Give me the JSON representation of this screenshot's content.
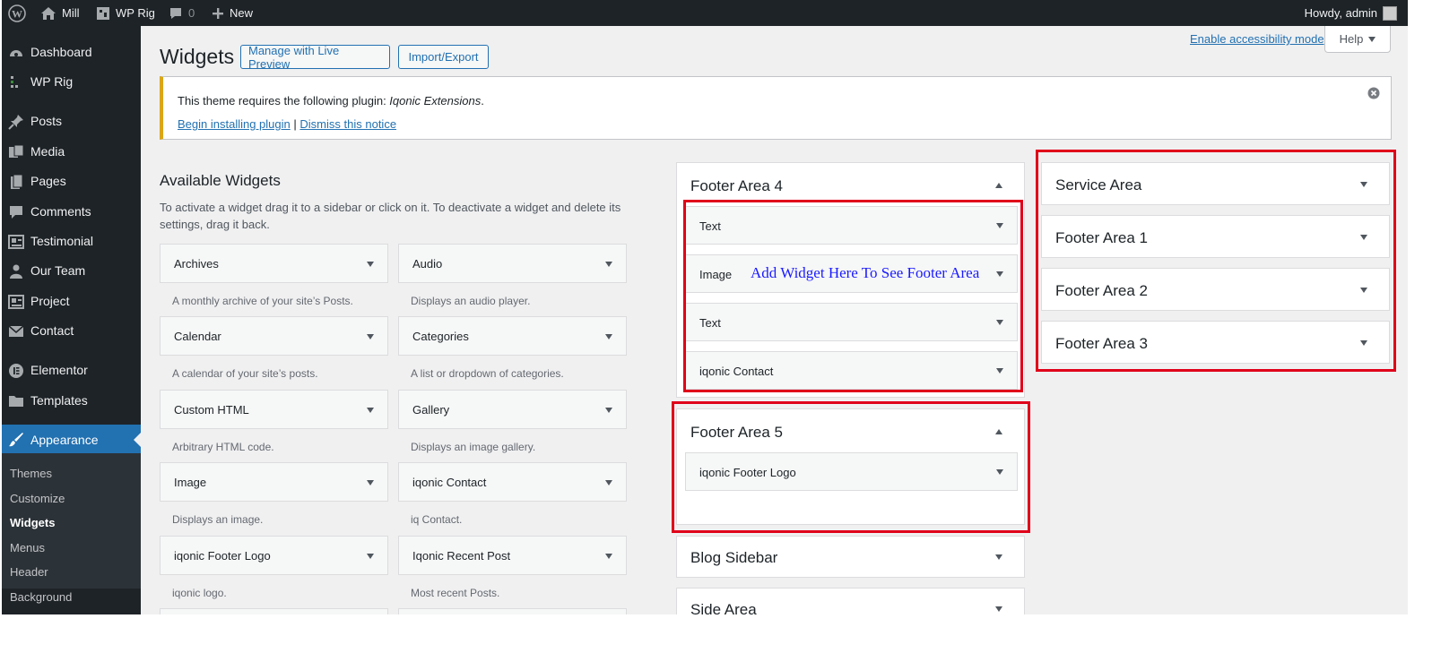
{
  "admin_bar": {
    "site_name": "Mill",
    "theme_item": "WP Rig",
    "comments_count": "0",
    "new_label": "New",
    "howdy": "Howdy, admin"
  },
  "sidebar": {
    "items": [
      {
        "label": "Dashboard",
        "icon": "dashboard-icon"
      },
      {
        "label": "WP Rig",
        "icon": "wp-rig-icon"
      },
      {
        "label": "Posts",
        "icon": "pin-icon"
      },
      {
        "label": "Media",
        "icon": "media-icon"
      },
      {
        "label": "Pages",
        "icon": "pages-icon"
      },
      {
        "label": "Comments",
        "icon": "comments-icon"
      },
      {
        "label": "Testimonial",
        "icon": "testimonial-icon"
      },
      {
        "label": "Our Team",
        "icon": "team-icon"
      },
      {
        "label": "Project",
        "icon": "project-icon"
      },
      {
        "label": "Contact",
        "icon": "mail-icon"
      },
      {
        "label": "Elementor",
        "icon": "elementor-icon"
      },
      {
        "label": "Templates",
        "icon": "folder-icon"
      },
      {
        "label": "Appearance",
        "icon": "brush-icon"
      }
    ],
    "submenu": [
      "Themes",
      "Customize",
      "Widgets",
      "Menus",
      "Header",
      "Background"
    ]
  },
  "page": {
    "title": "Widgets",
    "live_preview_button": "Manage with Live Preview",
    "import_export_button": "Import/Export",
    "accessibility_link": "Enable accessibility mode",
    "help_tab": "Help"
  },
  "notice": {
    "prefix": "This theme requires the following plugin: ",
    "plugin": "Iqonic Extensions",
    "suffix": ".",
    "install_link": "Begin installing plugin",
    "separator": "|",
    "dismiss_link": "Dismiss this notice"
  },
  "available": {
    "title": "Available Widgets",
    "description": "To activate a widget drag it to a sidebar or click on it. To deactivate a widget and delete its settings, drag it back.",
    "widgets": [
      {
        "title": "Archives",
        "desc": "A monthly archive of your site’s Posts."
      },
      {
        "title": "Audio",
        "desc": "Displays an audio player."
      },
      {
        "title": "Calendar",
        "desc": "A calendar of your site’s posts."
      },
      {
        "title": "Categories",
        "desc": "A list or dropdown of categories."
      },
      {
        "title": "Custom HTML",
        "desc": "Arbitrary HTML code."
      },
      {
        "title": "Gallery",
        "desc": "Displays an image gallery."
      },
      {
        "title": "Image",
        "desc": "Displays an image."
      },
      {
        "title": "iqonic Contact",
        "desc": "iq Contact."
      },
      {
        "title": "iqonic Footer Logo",
        "desc": "iqonic logo."
      },
      {
        "title": "Iqonic Recent Post",
        "desc": "Most recent Posts."
      }
    ]
  },
  "sidebars": {
    "footer4": {
      "title": "Footer Area 4",
      "widgets": [
        "Text",
        "Image",
        "Text",
        "iqonic Contact"
      ]
    },
    "annotation": "Add Widget Here To See Footer Area",
    "footer5": {
      "title": "Footer Area 5",
      "widgets": [
        "iqonic Footer Logo"
      ]
    },
    "blog_sidebar": "Blog Sidebar",
    "side_area": "Side Area",
    "service_area": "Service Area",
    "footer1": "Footer Area 1",
    "footer2": "Footer Area 2",
    "footer3": "Footer Area 3"
  },
  "colors": {
    "highlight_box": "#e0001a",
    "annotation_text": "#1a1aff",
    "admin_accent": "#2271b1",
    "notice_warning": "#dba617"
  }
}
